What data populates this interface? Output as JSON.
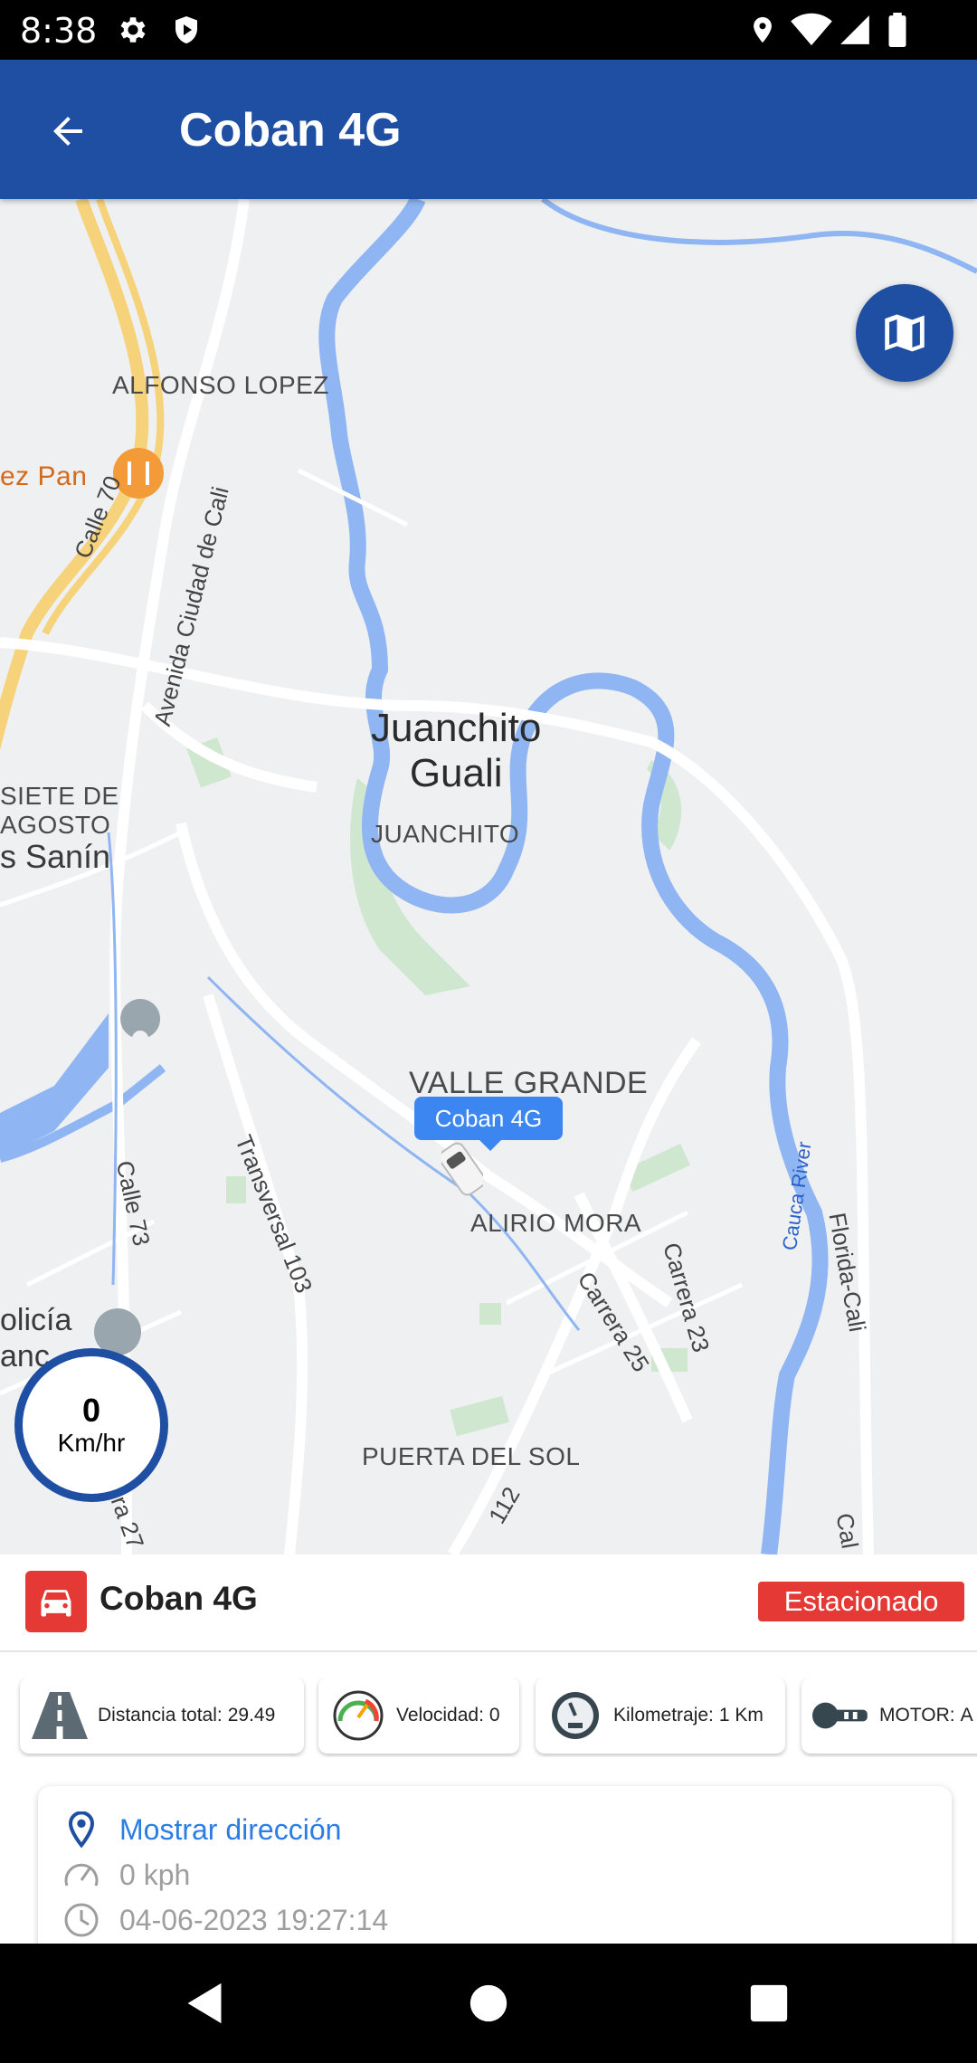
{
  "status_bar": {
    "time": "8:38"
  },
  "app_bar": {
    "title": "Coban 4G"
  },
  "map": {
    "labels": {
      "restaurant": "ez Pan",
      "alfonso_lopez": "ALFONSO LOPEZ",
      "calle_70": "Calle 70",
      "avenida": "Avenida Ciudad de Cali",
      "juanchito_gauli": "Juanchito\nGuali",
      "juanchito": "JUANCHITO",
      "siete_de": "SIETE DE",
      "agosto": "AGOSTO",
      "sanin": "s Sanín",
      "valle_grande": "VALLE GRANDE",
      "alirio_mora": "ALIRIO MORA",
      "transversal": "Transversal 103",
      "calle_73": "Calle 73",
      "carrera_25": "Carrera 25",
      "carrera_23": "Carrera 23",
      "cauca_river": "Cauca River",
      "florida_cali": "Florida-Cali",
      "puerta_del_sol": "PUERTA DEL SOL",
      "policia": "olicía",
      "policia2": "anc",
      "era_27": "era 27",
      "n112": "112",
      "cal": "Cal"
    },
    "marker_label": "Coban 4G",
    "speed": {
      "value": "0",
      "unit": "Km/hr"
    }
  },
  "panel": {
    "vehicle_name": "Coban 4G",
    "status": "Estacionado",
    "chips": [
      {
        "label": "Distancia total:",
        "value": "29.49"
      },
      {
        "label": "Velocidad:",
        "value": "0"
      },
      {
        "label": "Kilometraje:",
        "value": "1 Km"
      },
      {
        "label": "MOTOR:",
        "value": "A"
      }
    ],
    "info": {
      "address_link": "Mostrar dirección",
      "speed": "0 kph",
      "datetime": "04-06-2023 19:27:14"
    }
  },
  "colors": {
    "primary": "#1e4fa3",
    "status_red": "#e53935",
    "link_blue": "#2b7de3",
    "marker_blue": "#3b86f0"
  }
}
